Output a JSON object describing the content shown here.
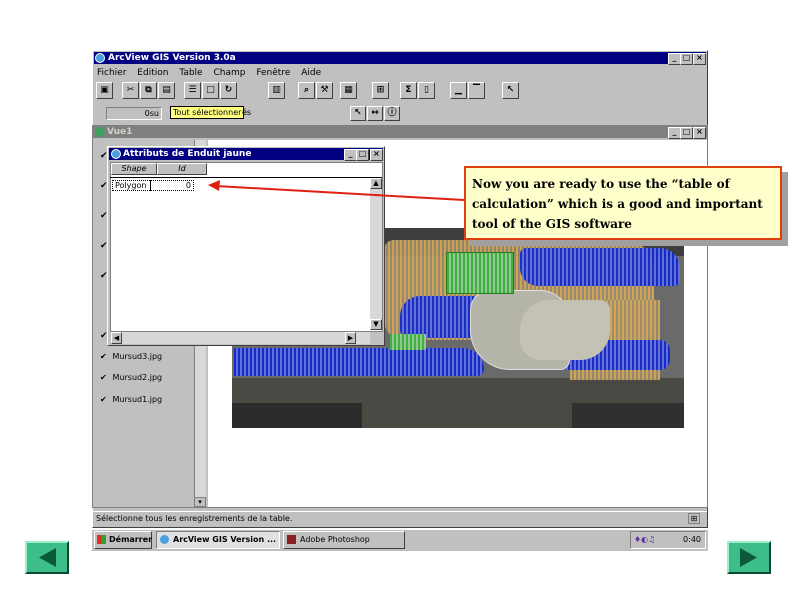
{
  "app": {
    "title": "ArcView GIS Version 3.0a",
    "menu": [
      "Fichier",
      "Edition",
      "Table",
      "Champ",
      "Fenêtre",
      "Aide"
    ],
    "toolbar_field_value": "0",
    "toolbar_field_suffix": "su",
    "tooltip": "Tout sélectionner",
    "toolbar_tail_text": "és",
    "status_text": "Sélectionne tous les enregistrements de la table."
  },
  "view": {
    "title": "Vue1",
    "layers": [
      {
        "label": "Mursud3.jpg",
        "checked": true
      },
      {
        "label": "Mursud2.jpg",
        "checked": true
      },
      {
        "label": "Mursud1.jpg",
        "checked": true
      }
    ]
  },
  "attr_table": {
    "title": "Attributs de Enduit jaune",
    "columns": [
      "Shape",
      "Id"
    ],
    "rows": [
      {
        "shape": "Polygon",
        "id": "0"
      }
    ]
  },
  "callout": {
    "text": "Now you are ready to use the “table of calculation” which is a good and important tool of the GIS software"
  },
  "taskbar": {
    "start": "Démarrer",
    "tasks": [
      "ArcView GIS Version ...",
      "Adobe Photoshop"
    ],
    "clock": "0:40"
  },
  "nav": {
    "prev": "previous-slide",
    "next": "next-slide"
  },
  "colors": {
    "titlebar_active": "#000080",
    "window_bg": "#c0c0c0",
    "callout_bg": "#ffffcc",
    "callout_border": "#e04010",
    "arrow": "#e02010",
    "nav_green": "#3cbd8a"
  }
}
